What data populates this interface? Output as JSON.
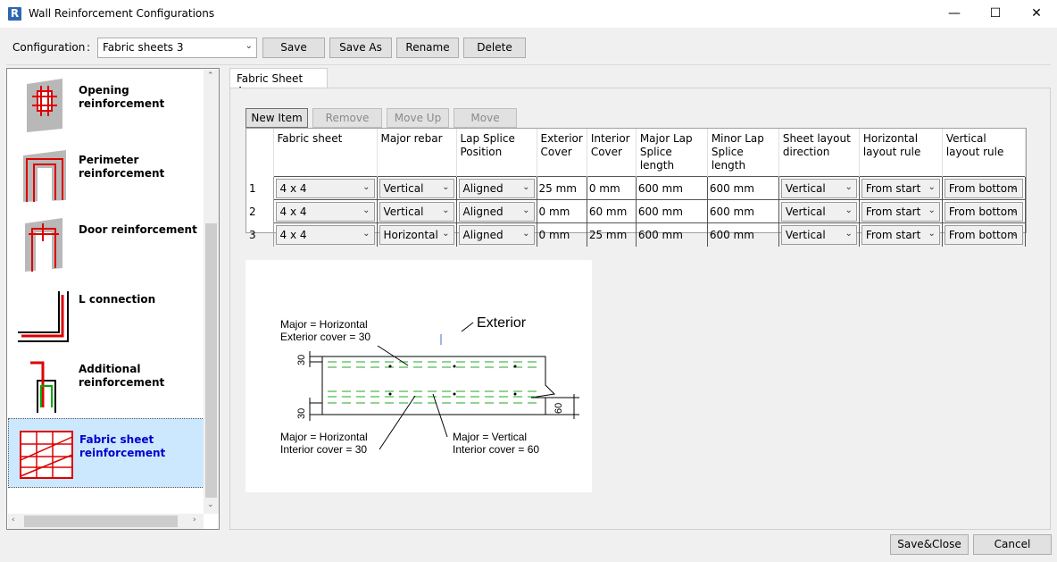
{
  "window": {
    "app_icon": "R",
    "title": "Wall Reinforcement Configurations",
    "controls": {
      "minimize": "—",
      "maximize": "☐",
      "close": "✕"
    }
  },
  "config": {
    "label": "Configuration",
    "colon": ":",
    "selected": "Fabric sheets 3",
    "buttons": {
      "save": "Save",
      "save_as": "Save As",
      "rename": "Rename",
      "delete": "Delete"
    }
  },
  "sidebar": {
    "items": [
      {
        "label": "Opening reinforcement",
        "icon": "opening-reinforcement-icon"
      },
      {
        "label": "Perimeter reinforcement",
        "icon": "perimeter-reinforcement-icon"
      },
      {
        "label": "Door reinforcement",
        "icon": "door-reinforcement-icon"
      },
      {
        "label": "L connection",
        "icon": "l-connection-icon"
      },
      {
        "label": "Additional reinforcement",
        "icon": "additional-reinforcement-icon"
      },
      {
        "label": "Fabric sheet reinforcement",
        "icon": "fabric-sheet-icon",
        "selected": true
      }
    ]
  },
  "tab": {
    "label": "Fabric Sheet Area"
  },
  "toolbar": {
    "new_item": "New Item",
    "remove_item": "Remove Item",
    "move_up": "Move Up",
    "move_down": "Move Down"
  },
  "grid": {
    "headers": [
      "Fabric sheet",
      "Major rebar",
      "Lap Splice Position",
      "Exterior Cover",
      "Interior Cover",
      "Major Lap Splice length",
      "Minor Lap Splice length",
      "Sheet layout direction",
      "Horizontal layout rule",
      "Vertical layout rule"
    ],
    "rows": [
      {
        "num": "1",
        "fabric": "4 x 4",
        "major": "Vertical",
        "lap": "Aligned",
        "ext": "25 mm",
        "int": "0 mm",
        "major_len": "600 mm",
        "minor_len": "600 mm",
        "dir": "Vertical",
        "hrule": "From start",
        "vrule": "From bottom"
      },
      {
        "num": "2",
        "fabric": "4 x 4",
        "major": "Vertical",
        "lap": "Aligned",
        "ext": "0 mm",
        "int": "60 mm",
        "major_len": "600 mm",
        "minor_len": "600 mm",
        "dir": "Vertical",
        "hrule": "From start",
        "vrule": "From bottom"
      },
      {
        "num": "3",
        "fabric": "4 x 4",
        "major": "Horizontal",
        "lap": "Aligned",
        "ext": "0 mm",
        "int": "25 mm",
        "major_len": "600 mm",
        "minor_len": "600 mm",
        "dir": "Vertical",
        "hrule": "From start",
        "vrule": "From bottom"
      }
    ]
  },
  "diagram": {
    "exterior": "Exterior",
    "top_left_1": "Major = Horizontal",
    "top_left_2": "Exterior cover = 30",
    "bottom_left_1": "Major = Horizontal",
    "bottom_left_2": "Interior cover = 30",
    "bottom_right_1": "Major = Vertical",
    "bottom_right_2": "Interior cover = 60",
    "dim_top": "30",
    "dim_bottom": "30",
    "dim_right": "60"
  },
  "footer": {
    "save_close": "Save&Close",
    "cancel": "Cancel"
  }
}
